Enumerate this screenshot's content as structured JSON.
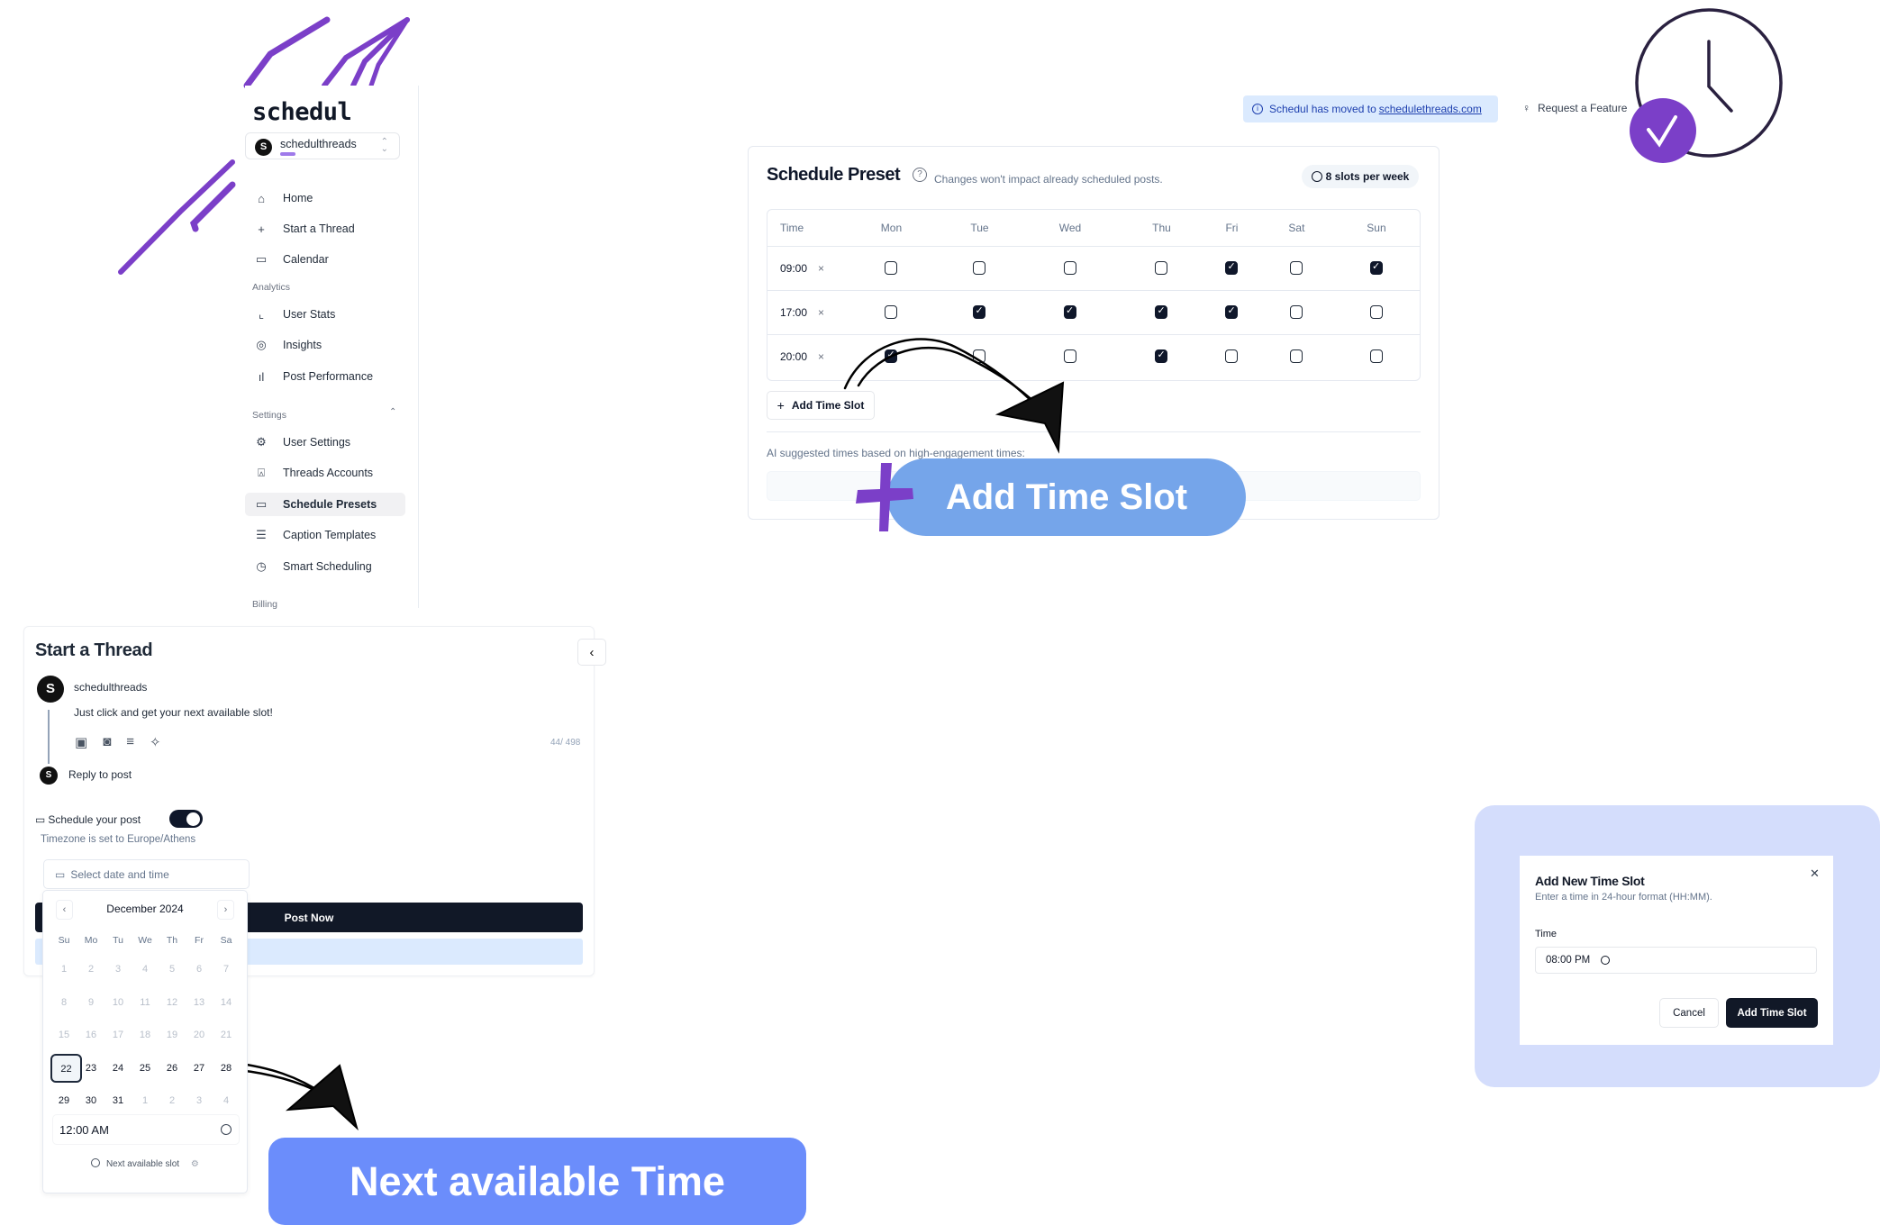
{
  "app": {
    "logo": "schedul",
    "account_name": "schedulthreads",
    "account_avatar_letter": "S"
  },
  "sidebar": {
    "items_top": [
      {
        "label": "Home",
        "icon": "home-icon"
      },
      {
        "label": "Start a Thread",
        "icon": "plus-icon"
      },
      {
        "label": "Calendar",
        "icon": "calendar-icon"
      }
    ],
    "analytics_label": "Analytics",
    "analytics_items": [
      {
        "label": "User Stats",
        "icon": "line-chart-icon"
      },
      {
        "label": "Insights",
        "icon": "scan-eye-icon"
      },
      {
        "label": "Post Performance",
        "icon": "bar-chart-icon"
      }
    ],
    "settings_label": "Settings",
    "settings_items": [
      {
        "label": "User Settings",
        "icon": "gear-icon"
      },
      {
        "label": "Threads Accounts",
        "icon": "account-badge-icon"
      },
      {
        "label": "Schedule Presets",
        "icon": "calendar-settings-icon",
        "active": true
      },
      {
        "label": "Caption Templates",
        "icon": "scroll-icon"
      },
      {
        "label": "Smart Scheduling",
        "icon": "calendar-clock-icon"
      }
    ],
    "billing_label": "Billing"
  },
  "topbar": {
    "banner_text": "Schedul has moved to",
    "banner_link": "schedulethreads.com",
    "request_feature": "Request a Feature"
  },
  "schedule_preset": {
    "title": "Schedule Preset",
    "subtitle": "Changes won't impact already scheduled posts.",
    "slots_badge": "8 slots per week",
    "columns": [
      "Time",
      "Mon",
      "Tue",
      "Wed",
      "Thu",
      "Fri",
      "Sat",
      "Sun"
    ],
    "rows": [
      {
        "time": "09:00",
        "days": [
          false,
          false,
          false,
          false,
          true,
          false,
          true
        ]
      },
      {
        "time": "17:00",
        "days": [
          false,
          true,
          true,
          true,
          true,
          false,
          false
        ]
      },
      {
        "time": "20:00",
        "days": [
          true,
          false,
          false,
          true,
          false,
          false,
          false
        ]
      }
    ],
    "remove_glyph": "×",
    "add_button": "Add Time Slot",
    "ai_label": "AI suggested times based on high-engagement times:"
  },
  "callouts": {
    "add_time_slot": "Add Time Slot",
    "next_available_time": "Next available Time"
  },
  "composer": {
    "title": "Start a Thread",
    "username": "schedulthreads",
    "post_text": "Just click and get your next available slot!",
    "char_count": "44/ 498",
    "reply_placeholder": "Reply to post",
    "schedule_label": "Schedule your post",
    "schedule_enabled": true,
    "timezone": "Timezone is set to Europe/Athens",
    "date_placeholder": "Select date and time",
    "post_now": "Post Now"
  },
  "calendar": {
    "month": "December 2024",
    "weekdays": [
      "Su",
      "Mo",
      "Tu",
      "We",
      "Th",
      "Fr",
      "Sa"
    ],
    "weeks": [
      [
        "1",
        "2",
        "3",
        "4",
        "5",
        "6",
        "7"
      ],
      [
        "8",
        "9",
        "10",
        "11",
        "12",
        "13",
        "14"
      ],
      [
        "15",
        "16",
        "17",
        "18",
        "19",
        "20",
        "21"
      ],
      [
        "22",
        "23",
        "24",
        "25",
        "26",
        "27",
        "28"
      ],
      [
        "29",
        "30",
        "31",
        "1",
        "2",
        "3",
        "4"
      ]
    ],
    "selected": "22",
    "time": "12:00 AM",
    "next_slot": "Next available slot"
  },
  "modal": {
    "title": "Add New Time Slot",
    "subtitle": "Enter a time in 24-hour format (HH:MM).",
    "field_label": "Time",
    "field_value": "08:00 PM",
    "cancel": "Cancel",
    "submit": "Add Time Slot"
  },
  "colors": {
    "accent_purple": "#7b3fc8",
    "callout_blue": "#75a5ea",
    "next_blue": "#6b8dfb",
    "dark": "#111827",
    "banner_bg": "#dbeafe",
    "modal_bg": "#d4ddfc"
  }
}
